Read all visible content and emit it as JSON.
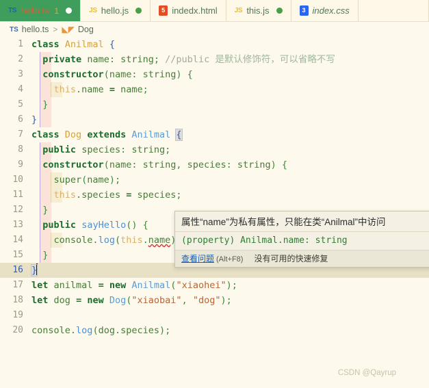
{
  "tabs": [
    {
      "icon": "typescript-icon",
      "icon_text": "TS",
      "label": "hello.ts",
      "badge": "1",
      "dot": "white",
      "active": true,
      "italic": false
    },
    {
      "icon": "javascript-icon",
      "icon_text": "JS",
      "label": "hello.js",
      "badge": "",
      "dot": "green",
      "active": false,
      "italic": false
    },
    {
      "icon": "html-icon",
      "icon_text": "5",
      "label": "indedx.html",
      "badge": "",
      "dot": "",
      "active": false,
      "italic": false
    },
    {
      "icon": "javascript-icon",
      "icon_text": "JS",
      "label": "this.js",
      "badge": "",
      "dot": "green",
      "active": false,
      "italic": false
    },
    {
      "icon": "css-icon",
      "icon_text": "3",
      "label": "index.css",
      "badge": "",
      "dot": "",
      "active": false,
      "italic": true
    }
  ],
  "breadcrumb": {
    "file_icon": "TS",
    "file": "hello.ts",
    "separator": ">",
    "symbol_icon": "class-icon",
    "symbol": "Dog"
  },
  "editor": {
    "current_line": 16,
    "lines": [
      {
        "n": "1",
        "text": "class Anilmal {"
      },
      {
        "n": "2",
        "text": "  private name: string; //public 是默认修饰符，可以省略不写"
      },
      {
        "n": "3",
        "text": "  constructor(name: string) {"
      },
      {
        "n": "4",
        "text": "    this.name = name;"
      },
      {
        "n": "5",
        "text": "  }"
      },
      {
        "n": "6",
        "text": "}"
      },
      {
        "n": "7",
        "text": "class Dog extends Anilmal {"
      },
      {
        "n": "8",
        "text": "  public species: string;"
      },
      {
        "n": "9",
        "text": "  constructor(name: string, species: string) {"
      },
      {
        "n": "10",
        "text": "    super(name);"
      },
      {
        "n": "11",
        "text": "    this.species = species;"
      },
      {
        "n": "12",
        "text": "  }"
      },
      {
        "n": "13",
        "text": "  public sayHello() {"
      },
      {
        "n": "14",
        "text": "    console.log(this.name);"
      },
      {
        "n": "15",
        "text": "  }"
      },
      {
        "n": "16",
        "text": "}"
      },
      {
        "n": "17",
        "text": "let anilmal = new Anilmal(\"xiaohei\");"
      },
      {
        "n": "18",
        "text": "let dog = new Dog(\"xiaobai\", \"dog\");"
      },
      {
        "n": "19",
        "text": ""
      },
      {
        "n": "20",
        "text": "console.log(dog.species);"
      }
    ]
  },
  "hover": {
    "message": "属性“name”为私有属性，只能在类“Anilmal”中访问",
    "signature": "(property) Anilmal.name: string",
    "action_link": "查看问题",
    "action_key": "(Alt+F8)",
    "no_fix": "没有可用的快速修复"
  },
  "watermark": "CSDN @Qayrup",
  "colors": {
    "editor_background": "#fdf9ec",
    "active_tab_background": "#3f9e5b",
    "current_line_highlight": "#e9e1c6",
    "indent_guide_1": "#fbe3d9",
    "indent_guide_2": "#f6eed3",
    "error_squiggle": "#d32f2f",
    "keyword": "#1c6b2e",
    "type": "#d6a23c",
    "string": "#b5653a",
    "comment": "#a8a89a"
  }
}
